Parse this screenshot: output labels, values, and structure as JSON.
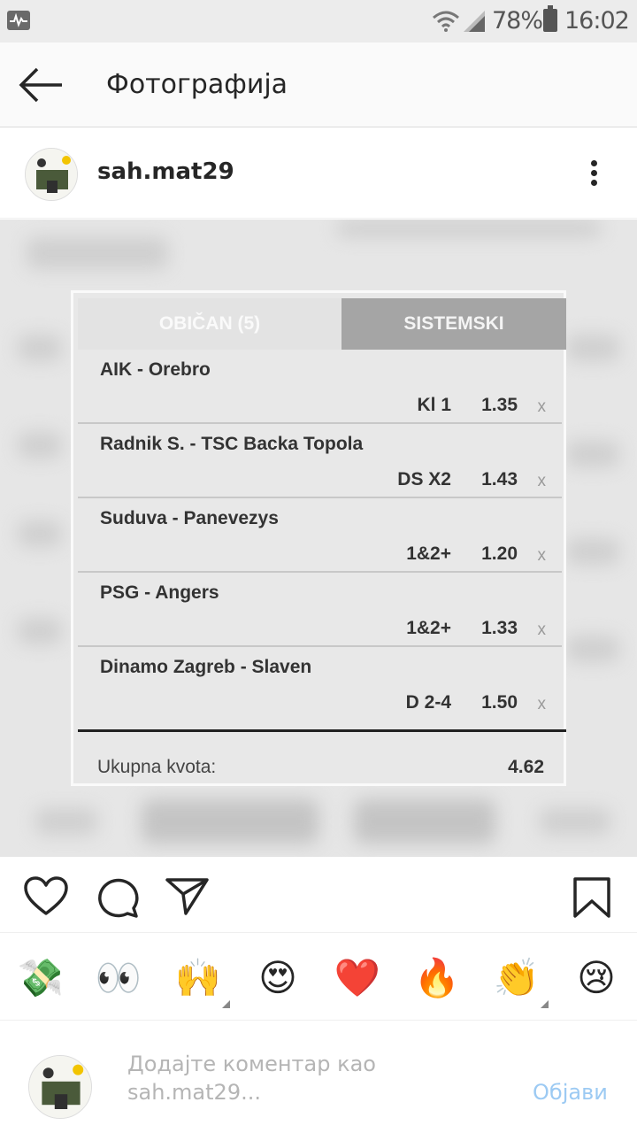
{
  "status_bar": {
    "battery": "78%",
    "time": "16:02",
    "icons": [
      "activity-icon",
      "wifi-icon",
      "signal-icon",
      "battery-icon"
    ]
  },
  "header": {
    "title": "Фотографија",
    "back_icon": "arrow-left-icon"
  },
  "post": {
    "username": "sah.mat29",
    "more_icon": "more-vertical-icon"
  },
  "ticket": {
    "tabs": [
      "OBIČAN (5)",
      "SISTEMSKI"
    ],
    "matches": [
      {
        "teams": "AIK - Orebro",
        "tip": "Kl 1",
        "odd": "1.35",
        "remove": "x"
      },
      {
        "teams": "Radnik S. - TSC Backa Topola",
        "tip": "DS X2",
        "odd": "1.43",
        "remove": "x"
      },
      {
        "teams": "Suduva - Panevezys",
        "tip": "1&2+",
        "odd": "1.20",
        "remove": "x"
      },
      {
        "teams": "PSG - Angers",
        "tip": "1&2+",
        "odd": "1.33",
        "remove": "x"
      },
      {
        "teams": "Dinamo Zagreb - Slaven",
        "tip": "D 2-4",
        "odd": "1.50",
        "remove": "x"
      }
    ],
    "total_label": "Ukupna kvota:",
    "total_value": "4.62"
  },
  "actions": {
    "icons": [
      "heart-icon",
      "comment-icon",
      "share-icon",
      "bookmark-icon"
    ]
  },
  "emojis": [
    "💸",
    "👀",
    "🙌",
    "😍",
    "❤️",
    "🔥",
    "👏",
    "😢"
  ],
  "comment": {
    "placeholder": "Додајте коментар као sah.mat29...",
    "post_label": "Објави"
  },
  "colors": {
    "accent_blue": "#9ccaf3",
    "status_bar_bg": "#ececec",
    "tab_active_bg": "#a5a5a5"
  }
}
